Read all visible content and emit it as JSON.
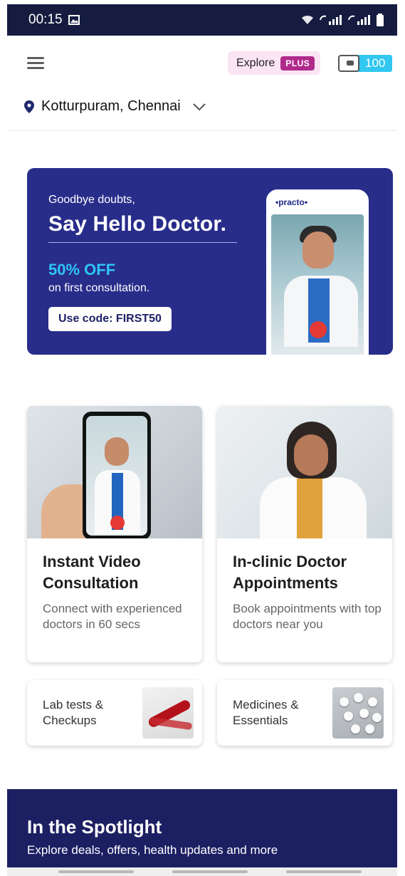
{
  "status_bar": {
    "time": "00:15",
    "icons": [
      "image-icon",
      "wifi-calling-icon",
      "signal-icon",
      "battery-icon"
    ]
  },
  "header": {
    "explore_label": "Explore",
    "plus_badge": "PLUS",
    "wallet_value": "100",
    "location": "Kotturpuram, Chennai"
  },
  "banner": {
    "subtitle": "Goodbye doubts,",
    "headline": "Say Hello Doctor.",
    "offer": "50% OFF",
    "offer_sub": "on first consultation.",
    "code_label": "Use code: FIRST50",
    "phone_brand": "•practo•"
  },
  "cards": [
    {
      "title": "Instant Video Consultation",
      "description": "Connect with experienced doctors in 60 secs"
    },
    {
      "title": "In-clinic Doctor Appointments",
      "description": "Book appointments with top doctors near you"
    }
  ],
  "mini_cards": [
    {
      "label": "Lab tests & Checkups"
    },
    {
      "label": "Medicines & Essentials"
    }
  ],
  "spotlight": {
    "title": "In the Spotlight",
    "subtitle": "Explore deals, offers, health updates and more"
  },
  "colors": {
    "brand_navy": "#282d8a",
    "accent_cyan": "#2ec5f5",
    "plus_magenta": "#b02a8c",
    "spotlight_bg": "#1d1f63"
  }
}
